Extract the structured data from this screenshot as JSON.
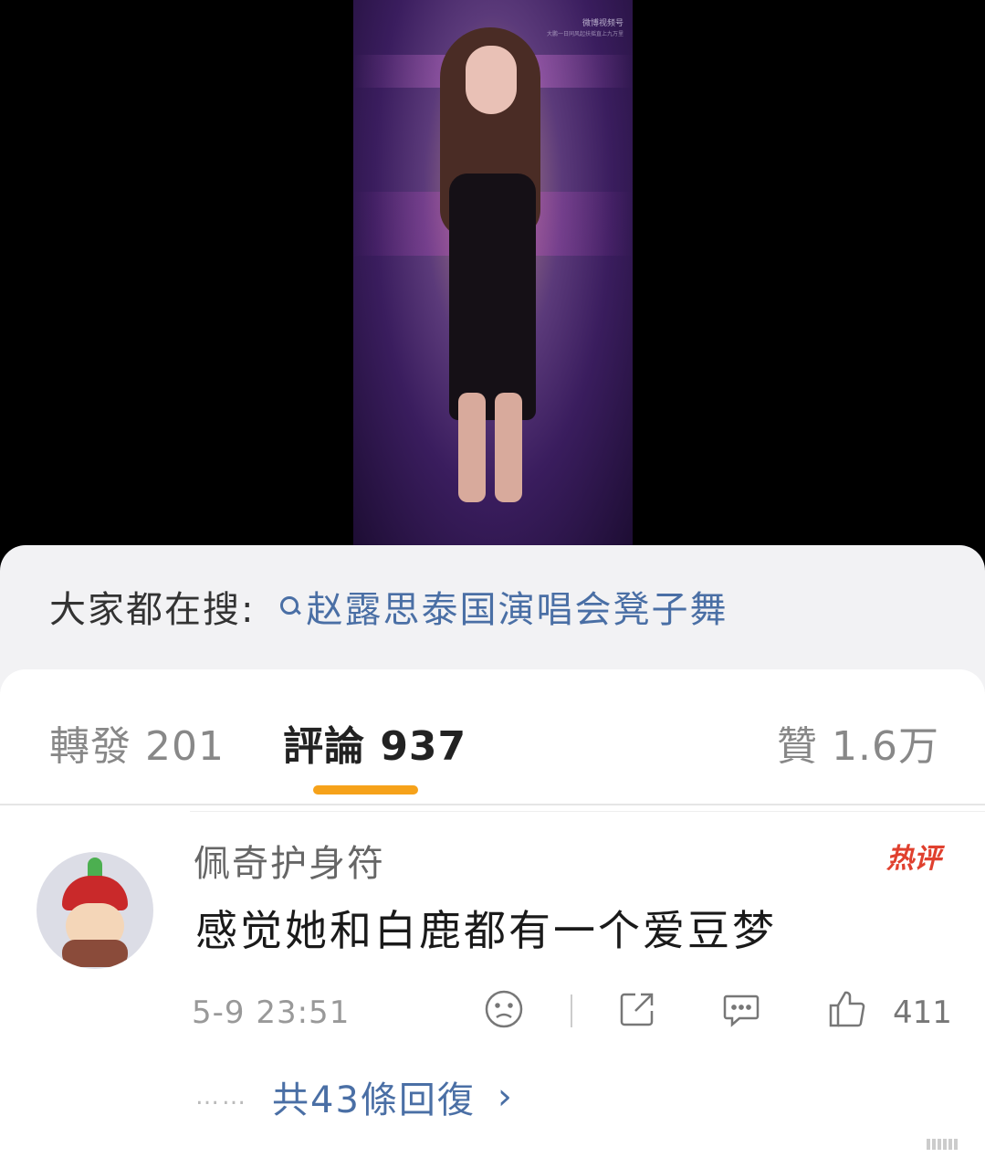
{
  "video": {
    "watermark": "微博视频号",
    "watermark_sub": "大鹏一日同风起扶摇直上九万里"
  },
  "search": {
    "label": "大家都在搜:",
    "term": "赵露思泰国演唱会凳子舞"
  },
  "tabs": {
    "repost": "轉發 201",
    "comment": "評論 937",
    "like": "贊 1.6万"
  },
  "comment": {
    "username": "佩奇护身符",
    "badge": "热评",
    "text": "感觉她和白鹿都有一个爱豆梦",
    "timestamp": "5-9 23:51",
    "like_count": "411",
    "replies_dots": "……",
    "replies_link": "共43條回復",
    "replies_chevron": "›"
  },
  "colors": {
    "accent_link": "#4a6fa5",
    "tab_indicator": "#f6a21a",
    "hot_badge": "#e0402e"
  },
  "icons": [
    "search-icon",
    "sad-face-icon",
    "share-icon",
    "reply-icon",
    "like-icon",
    "chevron-right-icon"
  ]
}
